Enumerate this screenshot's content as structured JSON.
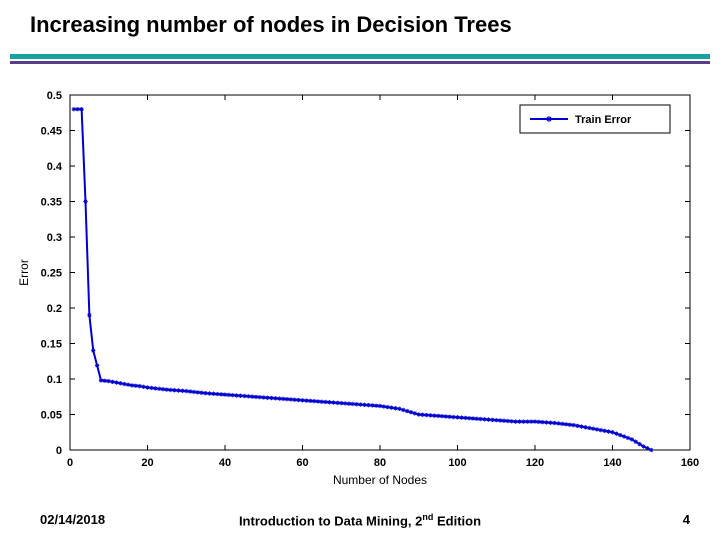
{
  "title": "Increasing number of nodes in Decision Trees",
  "footer": {
    "date": "02/14/2018",
    "book_prefix": "Introduction to Data Mining, 2",
    "book_sup": "nd",
    "book_suffix": " Edition",
    "page": "4"
  },
  "chart_data": {
    "type": "line",
    "title": "",
    "xlabel": "Number of Nodes",
    "ylabel": "Error",
    "xlim": [
      0,
      160
    ],
    "ylim": [
      0,
      0.5
    ],
    "xticks": [
      0,
      20,
      40,
      60,
      80,
      100,
      120,
      140,
      160
    ],
    "yticks": [
      0,
      0.05,
      0.1,
      0.15,
      0.2,
      0.25,
      0.3,
      0.35,
      0.4,
      0.45,
      0.5
    ],
    "legend": {
      "position": "top-right",
      "entries": [
        "Train Error"
      ]
    },
    "series": [
      {
        "name": "Train Error",
        "color": "#0000d0",
        "x": [
          1,
          2,
          3,
          4,
          5,
          6,
          8,
          10,
          12,
          14,
          16,
          18,
          20,
          25,
          30,
          35,
          40,
          45,
          50,
          55,
          60,
          65,
          70,
          75,
          80,
          85,
          90,
          95,
          100,
          105,
          110,
          115,
          120,
          125,
          130,
          135,
          140,
          145,
          148,
          150
        ],
        "y": [
          0.48,
          0.48,
          0.48,
          0.35,
          0.19,
          0.14,
          0.098,
          0.097,
          0.095,
          0.093,
          0.091,
          0.09,
          0.088,
          0.085,
          0.083,
          0.08,
          0.078,
          0.076,
          0.074,
          0.072,
          0.07,
          0.068,
          0.066,
          0.064,
          0.062,
          0.058,
          0.05,
          0.048,
          0.046,
          0.044,
          0.042,
          0.04,
          0.04,
          0.038,
          0.035,
          0.03,
          0.025,
          0.015,
          0.005,
          0.0
        ]
      }
    ]
  }
}
